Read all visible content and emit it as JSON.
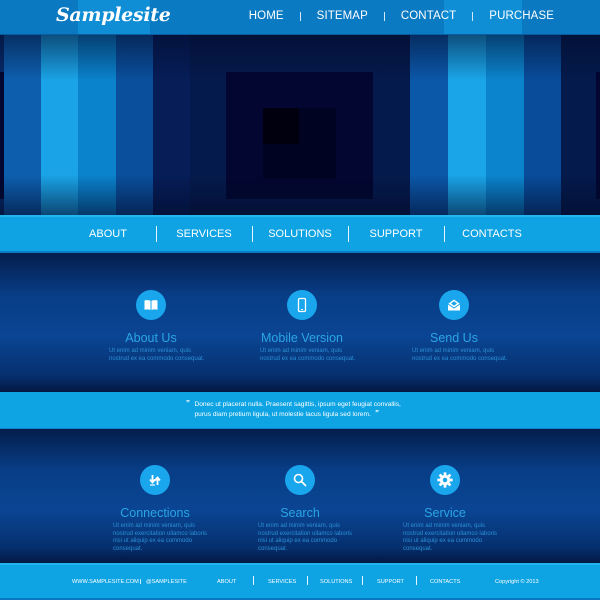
{
  "header": {
    "logo": "Samplesite",
    "nav": [
      "HOME",
      "SITEMAP",
      "CONTACT",
      "PURCHASE"
    ]
  },
  "hero": {
    "stripes": [
      {
        "color": "#072a6a"
      },
      {
        "color": "#0d5fae"
      },
      {
        "color": "#1aa3e6"
      },
      {
        "color": "#0a82cc"
      },
      {
        "color": "#0a4f9c"
      },
      {
        "color": "#061d57"
      },
      {
        "color": "#051a4c"
      },
      {
        "color": "#0b57a8"
      },
      {
        "color": "#1aa5e8"
      },
      {
        "color": "#0b84cd"
      },
      {
        "color": "#084c9a"
      },
      {
        "color": "#041a4c"
      }
    ]
  },
  "subnav": {
    "items": [
      "ABOUT",
      "SERVICES",
      "SOLUTIONS",
      "SUPPORT",
      "CONTACTS"
    ]
  },
  "features_top": [
    {
      "title": "About Us",
      "icon": "book-icon",
      "desc": "Ut enim ad minim veniam, quis nostrud ex ea commodo consequat."
    },
    {
      "title": "Mobile Version",
      "icon": "mobile-phone-icon",
      "desc": "Ut enim ad minim veniam, quis nostrud ex ea commodo consequat."
    },
    {
      "title": "Send Us",
      "icon": "envelope-icon",
      "desc": "Ut enim ad minim veniam, quis nostrud ex ea commodo consequat."
    }
  ],
  "quote": {
    "open": "”",
    "text": "Donec ut placerat nulla. Praesent sagittis, ipsum eget feugiat convallis, purus diam pretium ligula, ut molestie lacus ligula sed lorem.",
    "close": "”"
  },
  "features_bottom": [
    {
      "title": "Connections",
      "icon": "transfer-arrows-icon",
      "desc": "Ut enim ad minim veniam, quis nostrud exercitation ullamco laboris nisi ut aliquip ex ea commodo consequat."
    },
    {
      "title": "Search",
      "icon": "magnifier-icon",
      "desc": "Ut enim ad minim veniam, quis nostrud exercitation ullamco laboris nisi ut aliquip ex ea commodo consequat."
    },
    {
      "title": "Service",
      "icon": "gear-icon",
      "desc": "Ut enim ad minim veniam, quis nostrud exercitation ullamco laboris nisi ut aliquip ex ea commodo consequat."
    }
  ],
  "footer": {
    "website": "WWW.SAMPLESITE.COM",
    "handle": "@SAMPLESITE",
    "nav": [
      "ABOUT",
      "SERVICES",
      "SOLUTIONS",
      "SUPPORT",
      "CONTACTS"
    ],
    "copyright": "Copyright © 2013"
  },
  "colors": {
    "accent": "#0fa3e3",
    "header_blue": "#0a79c2",
    "dark_navy": "#031040",
    "feature_title": "#2aa5e6"
  }
}
